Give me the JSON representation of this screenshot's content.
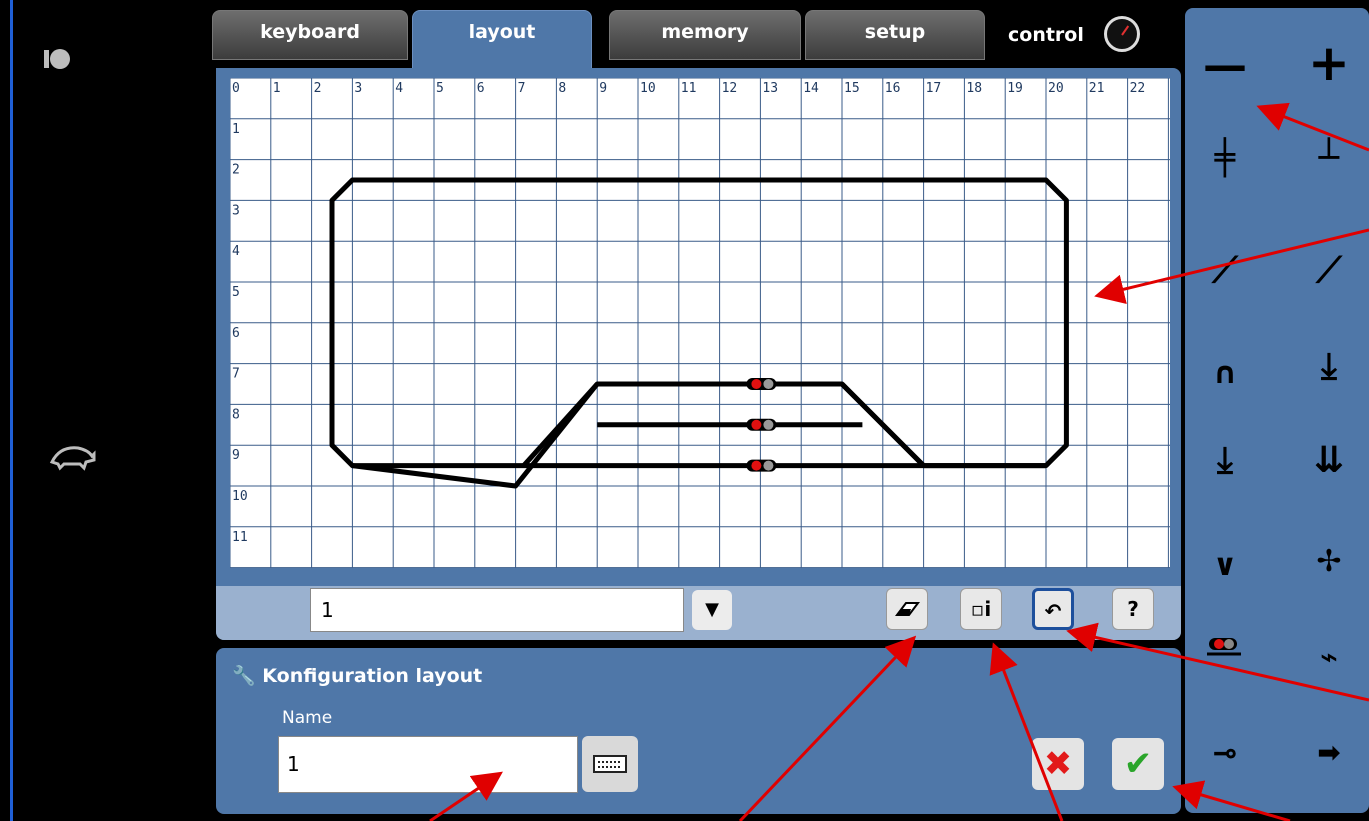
{
  "tabs": [
    {
      "label": "keyboard",
      "active": false
    },
    {
      "label": "layout",
      "active": true
    },
    {
      "label": "memory",
      "active": false
    },
    {
      "label": "setup",
      "active": false
    }
  ],
  "control": {
    "label": "control"
  },
  "grid": {
    "columns": [
      "0",
      "1",
      "2",
      "3",
      "4",
      "5",
      "6",
      "7",
      "8",
      "9",
      "10",
      "11",
      "12",
      "13",
      "14",
      "15",
      "16",
      "17",
      "18",
      "19",
      "20",
      "21",
      "22"
    ],
    "rows": [
      "0",
      "1",
      "2",
      "3",
      "4",
      "5",
      "6",
      "7",
      "8",
      "9",
      "10",
      "11"
    ]
  },
  "layout_select": {
    "value": "1"
  },
  "config": {
    "title": "Konfiguration layout",
    "name_label": "Name",
    "name_value": "1"
  },
  "colors": {
    "panel": "#4f77a8",
    "grid_line": "#3a5b88",
    "track": "#000000",
    "signal_red": "#e01010",
    "arrow": "#e00000"
  }
}
